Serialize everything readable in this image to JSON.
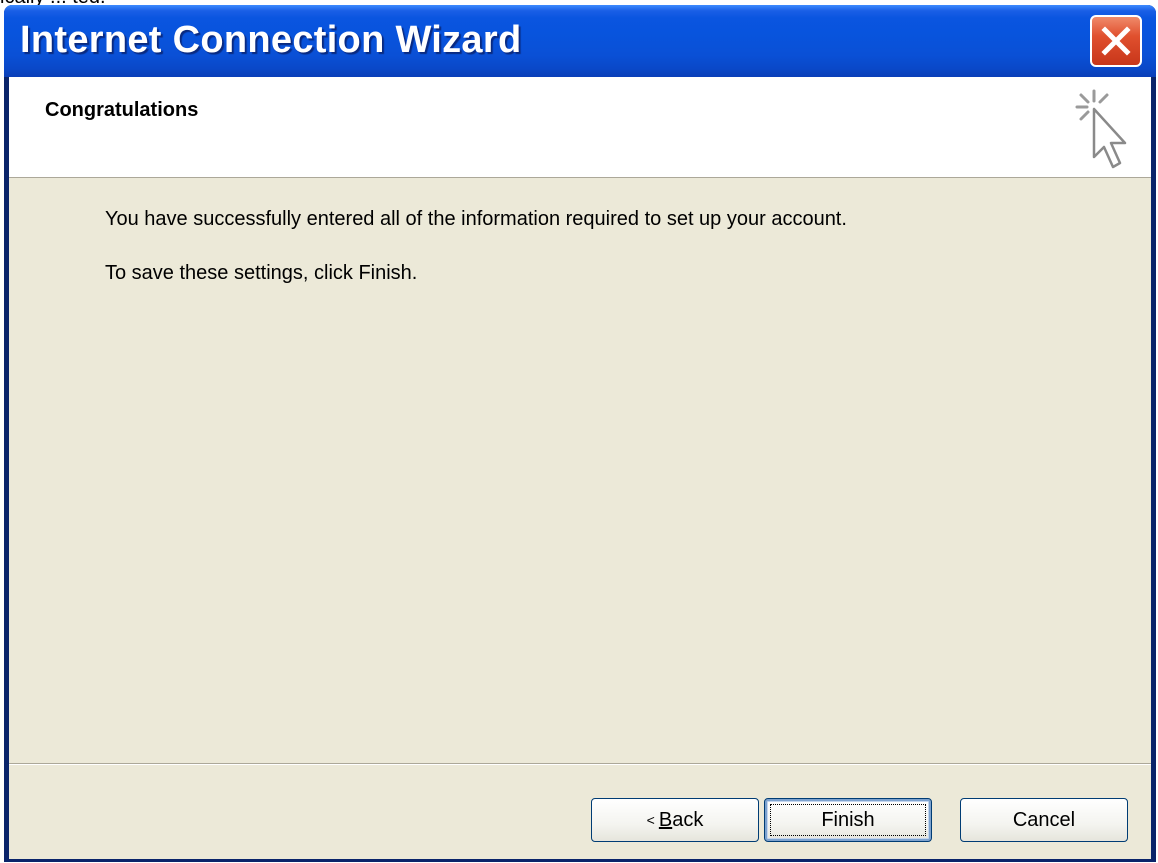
{
  "window": {
    "title": "Internet Connection Wizard",
    "background_text": "ically  ...  ted."
  },
  "header": {
    "title": "Congratulations"
  },
  "content": {
    "line1": "You have successfully entered all of the information required to set up your account.",
    "line2": "To save these settings, click Finish."
  },
  "buttons": {
    "back_prefix": "<",
    "back_accel": "B",
    "back_rest": "ack",
    "finish": "Finish",
    "cancel": "Cancel"
  },
  "icons": {
    "close": "close-icon",
    "wizard": "cursor-sparkle-icon"
  },
  "colors": {
    "titlebar": "#0a55e0",
    "client_bg": "#ece9d8",
    "close_bg": "#e0502e"
  }
}
